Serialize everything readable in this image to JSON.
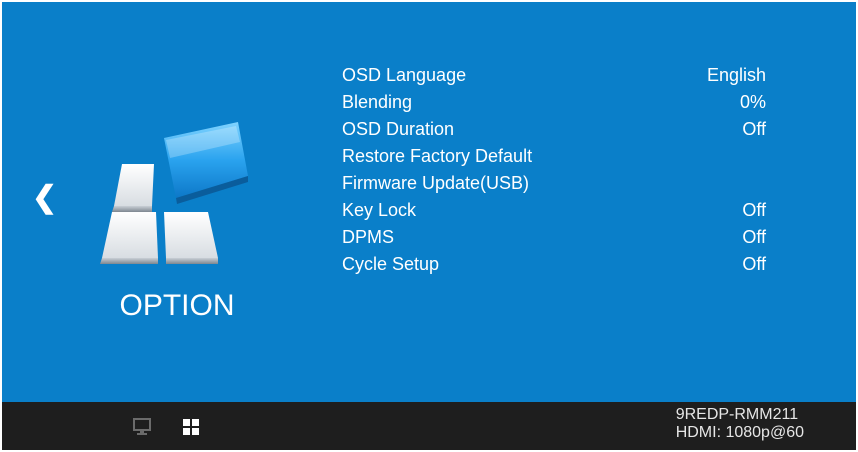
{
  "category": {
    "title": "OPTION",
    "icon": "option-blocks-icon"
  },
  "navigation": {
    "back_icon": "chevron-left-icon",
    "back_glyph": "❮"
  },
  "menu_items": [
    {
      "label": "OSD Language",
      "value": "English"
    },
    {
      "label": "Blending",
      "value": "0%"
    },
    {
      "label": "OSD Duration",
      "value": "Off"
    },
    {
      "label": "Restore Factory Default",
      "value": ""
    },
    {
      "label": "Firmware Update(USB)",
      "value": ""
    },
    {
      "label": "Key Lock",
      "value": "Off"
    },
    {
      "label": "DPMS",
      "value": "Off"
    },
    {
      "label": "Cycle Setup",
      "value": "Off"
    }
  ],
  "status_bar": {
    "icons": [
      "monitor-icon",
      "grid-icon"
    ],
    "model": "9REDP-RMM211",
    "signal": "HDMI: 1080p@60"
  },
  "colors": {
    "background": "#0a7fc9",
    "status_bar": "#1e1e1e",
    "text": "#ffffff"
  }
}
